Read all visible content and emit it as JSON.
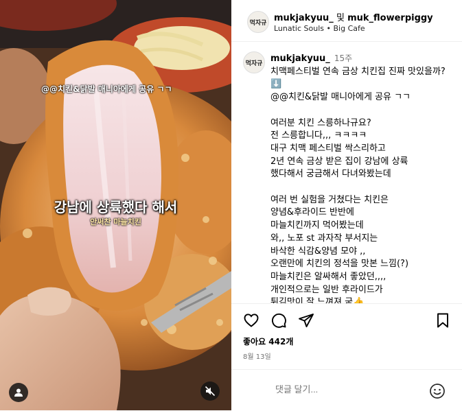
{
  "header": {
    "avatar_text": "먹자규",
    "user1": "mukjakyuu_",
    "connector": "및",
    "user2": "muk_flowerpiggy",
    "audio": "Lunatic Souls",
    "location": "Big Cafe",
    "separator": " • "
  },
  "media": {
    "caption_small": "@@치킨&닭발 매니아에게 공유 ㄱㄱ",
    "caption_big": "강남에 상륙했다 해서",
    "caption_sub": "안써찬 마늘치킨",
    "user_icon": "user-icon",
    "mute_icon": "mute-icon"
  },
  "comment": {
    "avatar_text": "먹자규",
    "username": "mukjakyuu_",
    "time": "15주",
    "lines": [
      "치맥페스티벌 연속 금상 치킨집 진짜 맛있을까? ⬇️",
      "@@치킨&닭발 매니아에게 공유 ㄱㄱ",
      "",
      "여러분 치킨 스릉하나규요?",
      "전 스릉합니다,,, ㅋㅋㅋㅋ",
      "대구 치맥 페스티벌 싹스리하고",
      "2년 연속 금상 받은 집이 강남에 상륙",
      "했다해서 궁금해서 다녀와봤는데",
      "",
      "여러 번 실험을 거쳤다는 치킨은",
      "양념&후라이드 반반에",
      "마늘치킨까지 먹어봤는데",
      "와,, 노포 st 과자작 부서지는",
      "바삭한 식감&양념 모야 ,,",
      "오랜만에 치킨의 정석을 맛본 느낌(?)",
      "마늘치킨은 알싸해서 좋았던,,,,",
      "개인적으로는 일반 후라이드가",
      "튀김맛이 잘 느껴져 굳👍"
    ]
  },
  "actions": {
    "like_icon": "heart-icon",
    "comment_icon": "comment-icon",
    "share_icon": "share-icon",
    "save_icon": "bookmark-icon"
  },
  "likes": "좋아요 442개",
  "date": "8월 13일",
  "add_comment": {
    "placeholder": "댓글 달기...",
    "emoji_icon": "emoji-icon"
  }
}
